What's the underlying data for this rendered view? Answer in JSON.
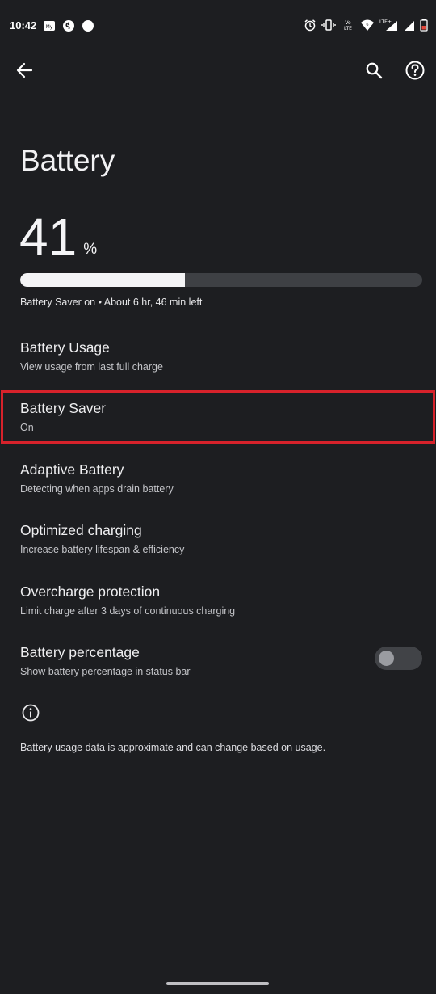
{
  "status_bar": {
    "time": "10:42",
    "network_label": "LTE+",
    "volte_label": "Vo LTE"
  },
  "header": {
    "title": "Battery"
  },
  "battery": {
    "level": "41",
    "unit": "%",
    "level_fraction": 0.41,
    "summary": "Battery Saver on • About 6 hr, 46 min left"
  },
  "settings": [
    {
      "title": "Battery Usage",
      "subtitle": "View usage from last full charge"
    },
    {
      "title": "Battery Saver",
      "subtitle": "On"
    },
    {
      "title": "Adaptive Battery",
      "subtitle": "Detecting when apps drain battery"
    },
    {
      "title": "Optimized charging",
      "subtitle": "Increase battery lifespan & efficiency"
    },
    {
      "title": "Overcharge protection",
      "subtitle": "Limit charge after 3 days of continuous charging"
    },
    {
      "title": "Battery percentage",
      "subtitle": "Show battery percentage in status bar",
      "toggle_on": false
    }
  ],
  "footer": {
    "note": "Battery usage data is approximate and can change based on usage."
  },
  "colors": {
    "background": "#1d1e21",
    "highlight": "#d7222b",
    "battery_fill": "#f4f4f6",
    "battery_track": "#3e4044"
  }
}
